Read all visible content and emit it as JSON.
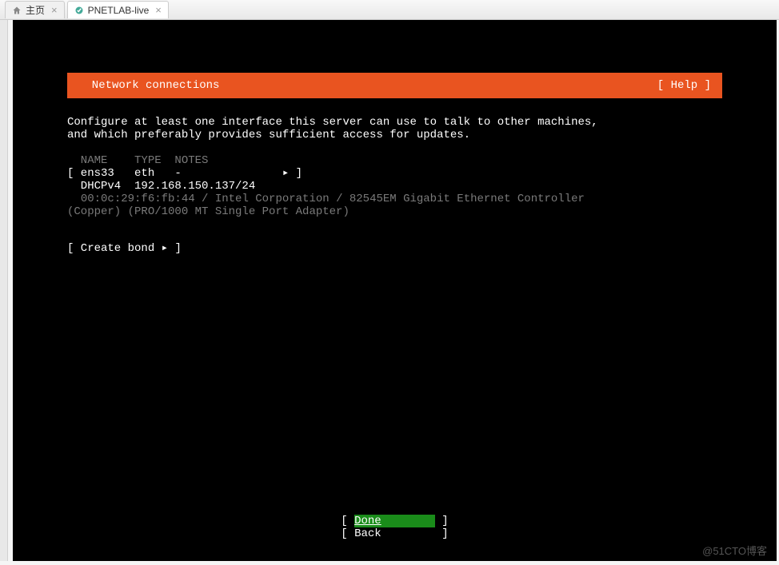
{
  "browser": {
    "tabs": [
      {
        "label": "主页",
        "icon": "home-icon"
      },
      {
        "label": "PNETLAB-live",
        "icon": "pnet-icon"
      }
    ]
  },
  "colors": {
    "accent": "#e95420",
    "selected": "#1a8c1a",
    "dim": "#7a7a7a"
  },
  "header": {
    "title": "  Network connections",
    "help": "[ Help ]"
  },
  "description": {
    "line1": "Configure at least one interface this server can use to talk to other machines,",
    "line2": "and which preferably provides sufficient access for updates."
  },
  "table": {
    "header": "  NAME    TYPE  NOTES",
    "iface_row": "[ ens33   eth   -               ▸ ]",
    "iface_addr": "  DHCPv4  192.168.150.137/24",
    "iface_info": "  00:0c:29:f6:fb:44 / Intel Corporation / 82545EM Gigabit Ethernet Controller\n(Copper) (PRO/1000 MT Single Port Adapter)"
  },
  "actions": {
    "create_bond": "[ Create bond ▸ ]"
  },
  "footer": {
    "done_open": "[ ",
    "done_label": "Done",
    "done_pad": "        ",
    "done_close": " ]",
    "back": "[ Back         ]"
  },
  "watermark": "@51CTO博客"
}
